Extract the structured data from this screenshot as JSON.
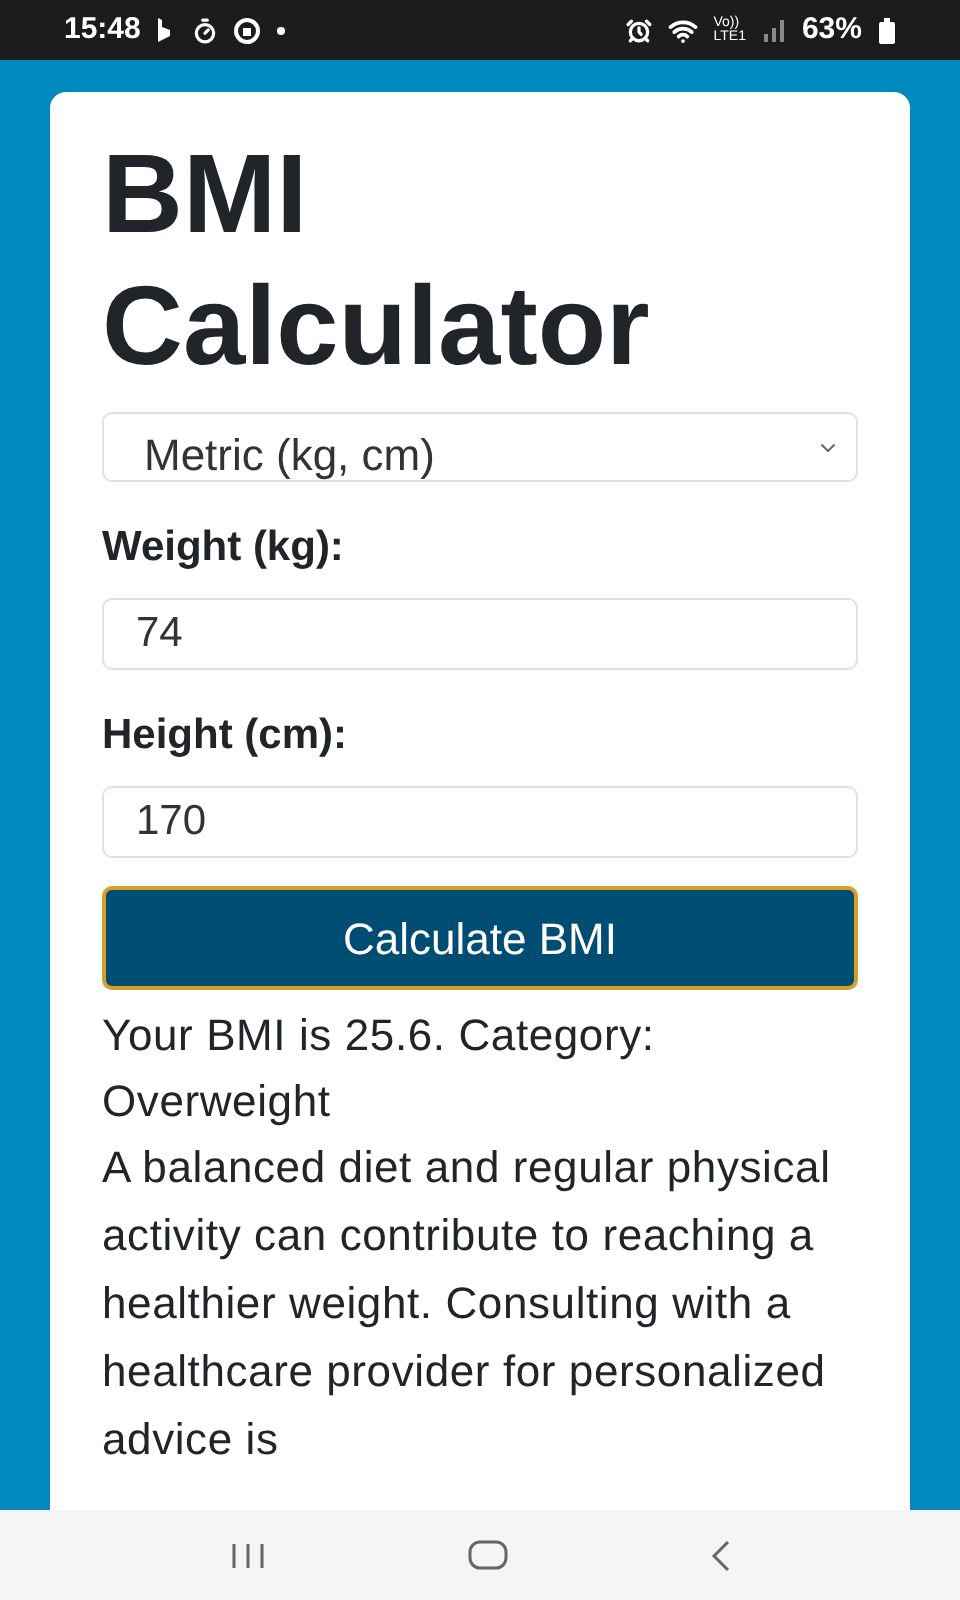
{
  "status_bar": {
    "time": "15:48",
    "network_top": "Vo))",
    "network_bottom": "LTE1",
    "battery": "63%"
  },
  "card": {
    "title": "BMI Calculator",
    "unit_select": {
      "value": "Metric (kg, cm)"
    },
    "fields": [
      {
        "label": "Weight (kg):",
        "value": "74"
      },
      {
        "label": "Height (cm):",
        "value": "170"
      }
    ],
    "button": "Calculate BMI",
    "result": "Your BMI is 25.6. Category: Overweight",
    "advice": "A balanced diet and regular physical activity can contribute to reaching a healthier weight. Consulting with a healthcare provider for personalized advice is"
  }
}
